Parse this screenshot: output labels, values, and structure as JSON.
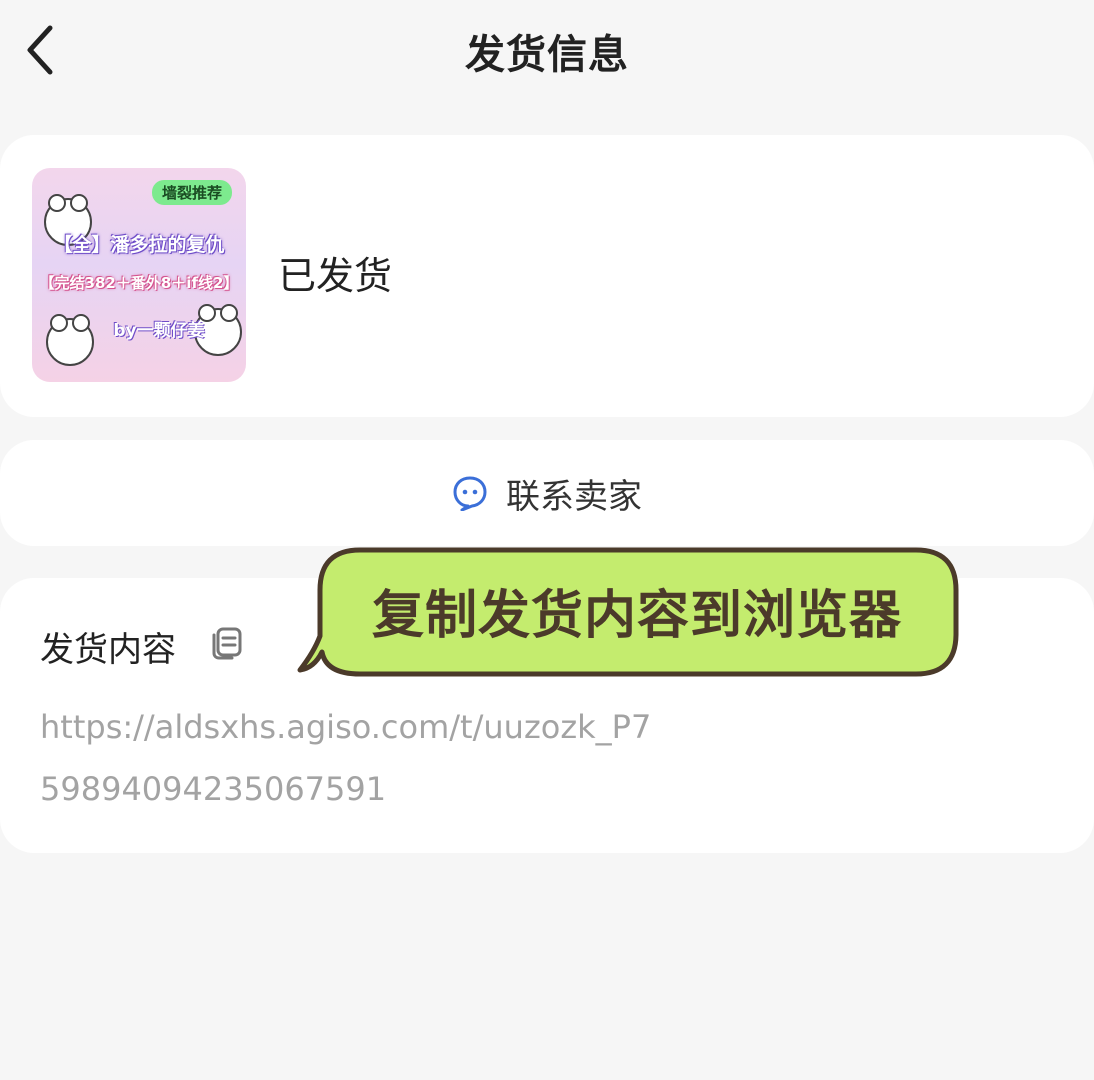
{
  "header": {
    "title": "发货信息",
    "back_icon": "chevron-left-icon"
  },
  "product": {
    "thumbnail": {
      "badge": "墙裂推荐",
      "line1": "【全】潘多拉的复仇",
      "line2": "【完结382＋番外8＋if线2】",
      "line3": "by一颗仔姜"
    },
    "status": "已发货"
  },
  "contact": {
    "icon": "chat-bubble-icon",
    "label": "联系卖家",
    "accent": "#3b6fd8"
  },
  "delivery": {
    "title": "发货内容",
    "copy_icon": "copy-icon",
    "url": "https://aldsxhs.agiso.com/t/uuzozk_P759894094235067591"
  },
  "overlay": {
    "bubble_text": "复制发货内容到浏览器",
    "bubble_color": "#c4ec6e",
    "bubble_border": "#4b3a2a"
  }
}
